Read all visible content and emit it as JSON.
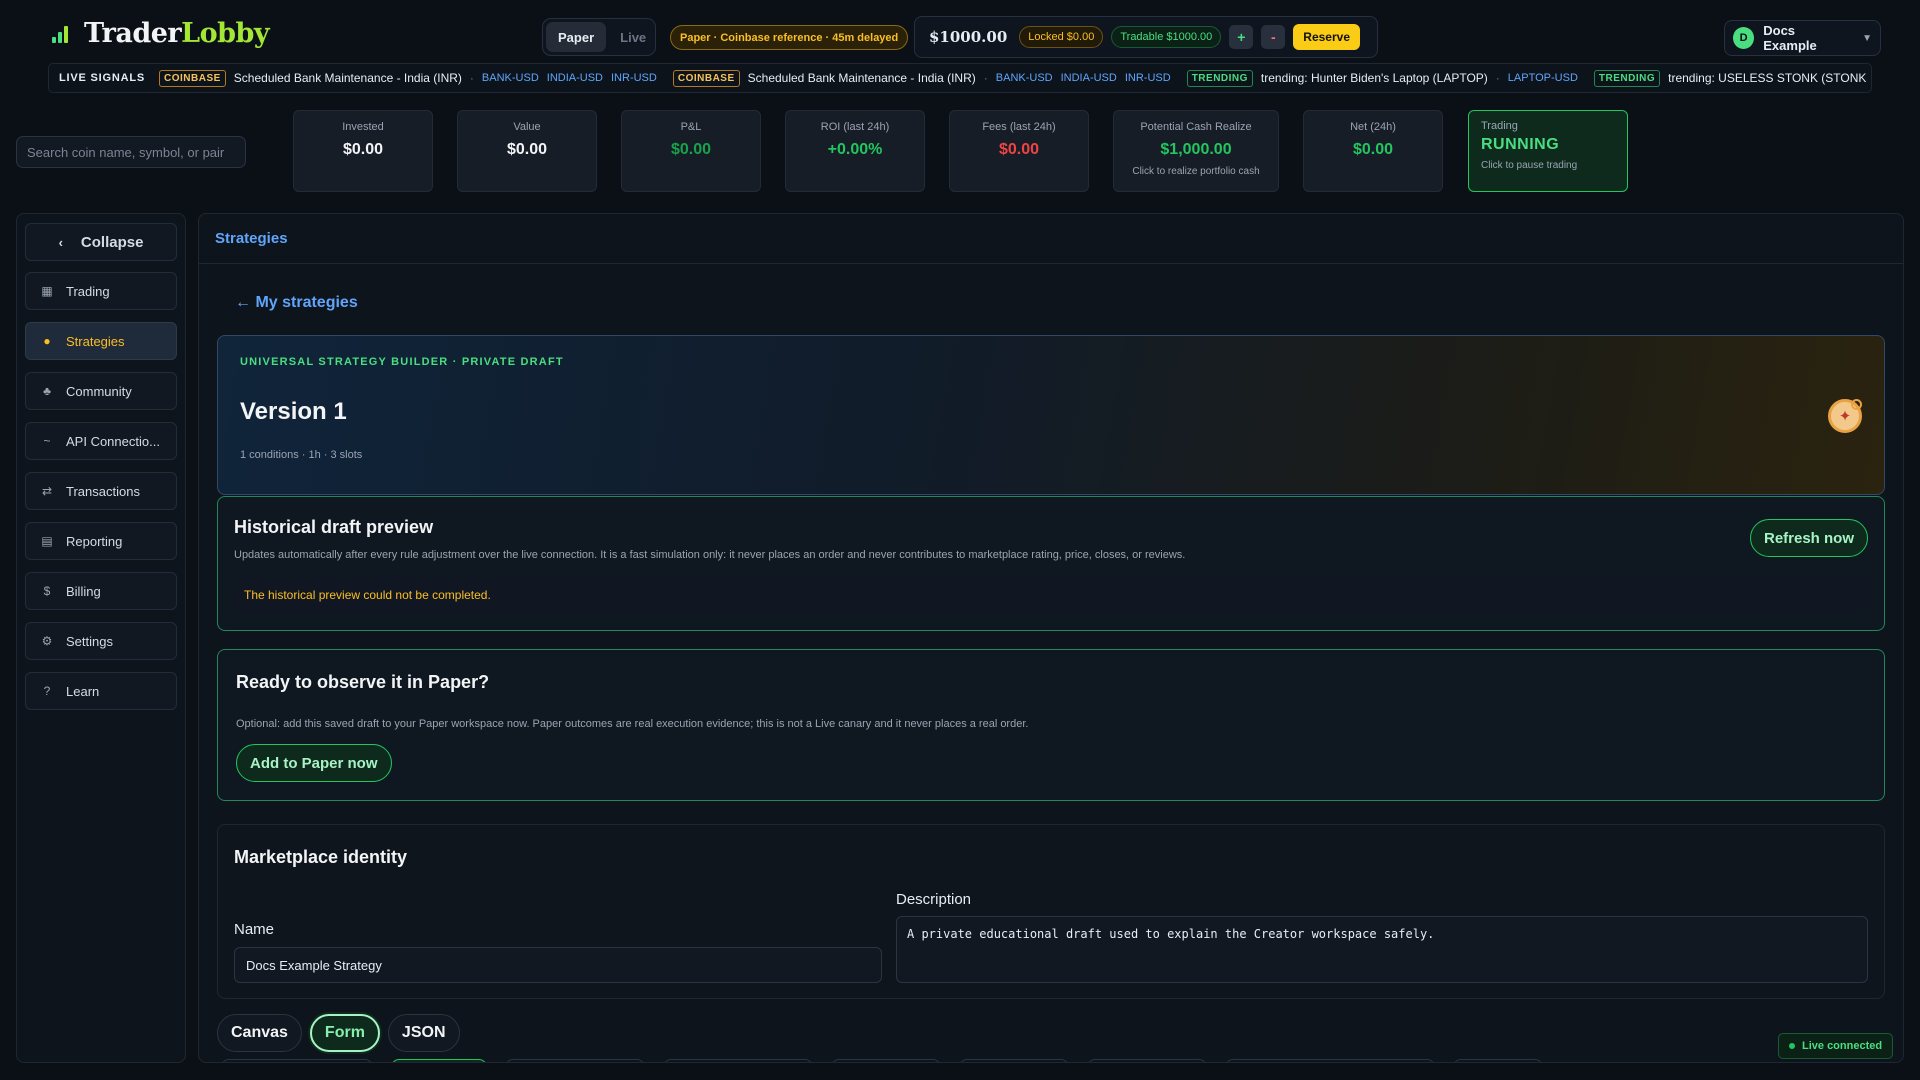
{
  "brand": {
    "name_a": "Trader",
    "name_b": "Lobby"
  },
  "mode": {
    "paper": "Paper",
    "live": "Live",
    "selected": "Paper"
  },
  "reference_badge": "Paper · Coinbase reference · 45m delayed",
  "wallet": {
    "balance": "$1000.00",
    "locked": "Locked $0.00",
    "tradable": "Tradable $1000.00",
    "plus": "+",
    "minus": "-",
    "reserve": "Reserve"
  },
  "user": {
    "initial": "D",
    "name": "Docs Example",
    "caret": "▼"
  },
  "ticker": {
    "label": "LIVE SIGNALS",
    "items": [
      {
        "tag": "COINBASE",
        "kind": "coinbase",
        "text": "Scheduled Bank Maintenance - India (INR)",
        "pairs": [
          "BANK-USD",
          "INDIA-USD",
          "INR-USD"
        ]
      },
      {
        "tag": "COINBASE",
        "kind": "coinbase",
        "text": "Scheduled Bank Maintenance - India (INR)",
        "pairs": [
          "BANK-USD",
          "INDIA-USD",
          "INR-USD"
        ]
      },
      {
        "tag": "TRENDING",
        "kind": "trending",
        "text": "trending: Hunter Biden's Laptop (LAPTOP)",
        "pairs": [
          "LAPTOP-USD"
        ]
      },
      {
        "tag": "TRENDING",
        "kind": "trending",
        "text": "trending: USELESS STONK (STONK",
        "pairs": []
      }
    ]
  },
  "search": {
    "placeholder": "Search coin name, symbol, or pair"
  },
  "stats": {
    "invested": {
      "label": "Invested",
      "value": "$0.00"
    },
    "value": {
      "label": "Value",
      "value": "$0.00"
    },
    "pnl": {
      "label": "P&L",
      "value": "$0.00"
    },
    "roi": {
      "label": "ROI (last 24h)",
      "value": "+0.00%"
    },
    "fees": {
      "label": "Fees (last 24h)",
      "value": "$0.00"
    },
    "cash": {
      "label": "Potential Cash Realize",
      "value": "$1,000.00",
      "sub": "Click to realize portfolio cash"
    },
    "net": {
      "label": "Net (24h)",
      "value": "$0.00"
    },
    "trading": {
      "label": "Trading",
      "value": "RUNNING",
      "sub": "Click to pause trading"
    }
  },
  "sidebar": {
    "collapse": "Collapse",
    "items": [
      {
        "label": "Trading",
        "icon": "grid-icon"
      },
      {
        "label": "Strategies",
        "icon": "strategy-icon"
      },
      {
        "label": "Community",
        "icon": "community-icon"
      },
      {
        "label": "API Connectio...",
        "icon": "api-icon"
      },
      {
        "label": "Transactions",
        "icon": "transfer-icon"
      },
      {
        "label": "Reporting",
        "icon": "report-icon"
      },
      {
        "label": "Billing",
        "icon": "dollar-icon"
      },
      {
        "label": "Settings",
        "icon": "gear-icon"
      },
      {
        "label": "Learn",
        "icon": "question-icon"
      }
    ],
    "active": "Strategies"
  },
  "main": {
    "breadcrumb": "Strategies",
    "back_link": "← My strategies",
    "hero": {
      "kicker": "UNIVERSAL STRATEGY BUILDER · PRIVATE DRAFT",
      "title": "Version 1",
      "meta": "1 conditions · 1h · 3 slots"
    },
    "preview": {
      "title": "Historical draft preview",
      "description": "Updates automatically after every rule adjustment over the live connection. It is a fast simulation only: it never places an order and never contributes to marketplace rating, price, closes, or reviews.",
      "refresh": "Refresh now",
      "error": "The historical preview could not be completed."
    },
    "ready": {
      "title": "Ready to observe it in Paper?",
      "description": "Optional: add this saved draft to your Paper workspace now. Paper outcomes are real execution evidence; this is not a Live canary and it never places a real order.",
      "button": "Add to Paper now"
    },
    "identity": {
      "title": "Marketplace identity",
      "name_label": "Name",
      "name_value": "Docs Example Strategy",
      "description_label": "Description",
      "description_value": "A private educational draft used to explain the Creator workspace safely."
    },
    "tabs": [
      {
        "label": "Canvas",
        "active": false
      },
      {
        "label": "Form",
        "active": true
      },
      {
        "label": "JSON",
        "active": false
      }
    ]
  },
  "status": {
    "live": "Live connected"
  },
  "colors": {
    "accent_green": "#22c55e",
    "accent_yellow": "#fbbf24",
    "link_blue": "#60a5fa",
    "danger_red": "#ef4444"
  }
}
